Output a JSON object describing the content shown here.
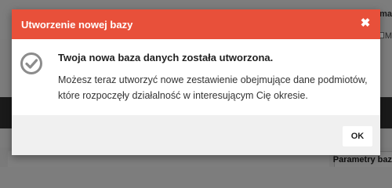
{
  "background": {
    "top_right_text": "ma",
    "top_right_small": "M",
    "params_label": "Parametry baz"
  },
  "dialog": {
    "title": "Utworzenie nowej bazy",
    "close_symbol": "✖",
    "icon": "check-circle-icon",
    "message_title": "Twoja nowa baza danych została utworzona.",
    "message_line1": "Możesz teraz utworzyć nowe zestawienie obejmujące dane podmiotów,",
    "message_line2": "które rozpoczęły działalność w interesującym Cię okresie.",
    "ok_label": "OK"
  },
  "colors": {
    "header": "#e8503a",
    "overlay": "#7d7d7d",
    "dark_band": "#1a1a1a",
    "icon_gray": "#8c8c8c"
  }
}
